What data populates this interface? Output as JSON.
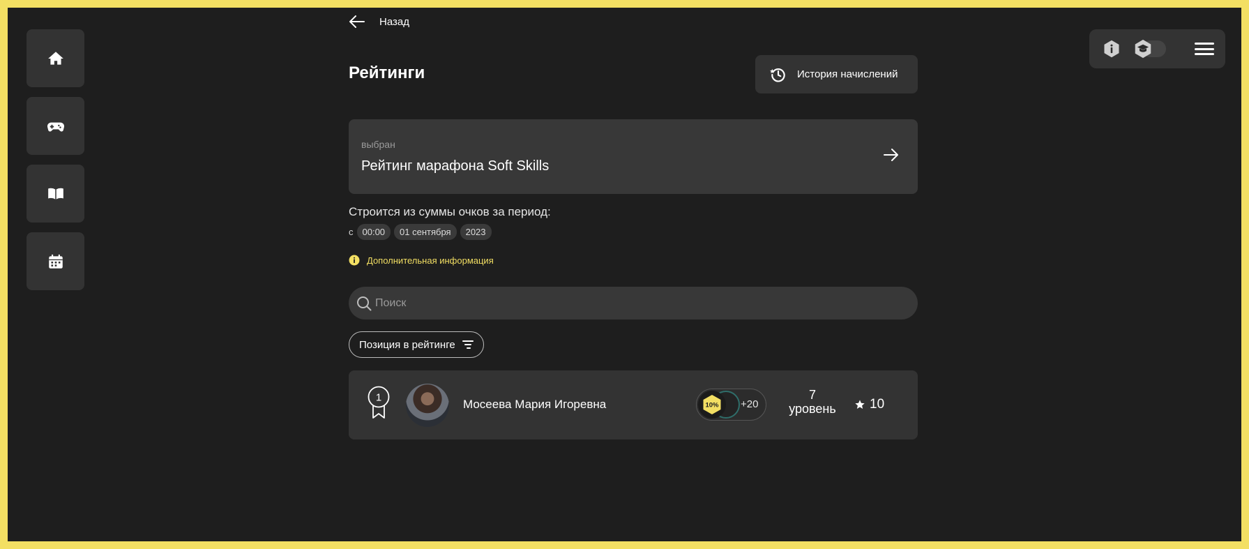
{
  "sidebar": {
    "items": [
      {
        "icon": "home-icon"
      },
      {
        "icon": "gamepad-icon"
      },
      {
        "icon": "book-icon"
      },
      {
        "icon": "calendar-icon"
      }
    ]
  },
  "toolbar": {
    "icons": [
      "info-icon",
      "graduation-cap-icon",
      "menu-icon"
    ]
  },
  "header": {
    "back_label": "Назад",
    "title": "Рейтинги",
    "history_button": "История начислений"
  },
  "selected_rating": {
    "label": "выбран",
    "name": "Рейтинг марафона Soft Skills"
  },
  "period": {
    "title": "Строится из суммы очков за период:",
    "prefix": "с",
    "time": "00:00",
    "date": "01 сентября",
    "year": "2023"
  },
  "info_link": "Дополнительная информация",
  "search": {
    "placeholder": "Поиск",
    "value": ""
  },
  "sort": {
    "label": "Позиция в рейтинге"
  },
  "ranking": [
    {
      "position": "1",
      "name": "Мосеева Мария Игоревна",
      "badge_label": "10%",
      "badges_more": "+20",
      "level_value": "7",
      "level_label": "уровень",
      "score": "10"
    }
  ],
  "colors": {
    "accent": "#f3df63",
    "background": "#1e1e1e",
    "card": "#333333"
  }
}
